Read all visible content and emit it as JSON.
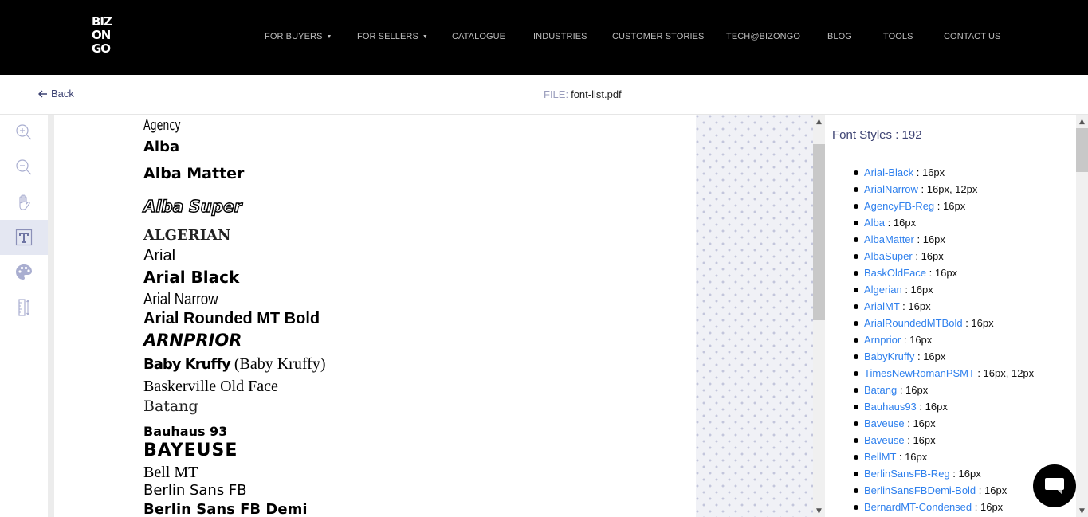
{
  "brand": {
    "logo_lines": [
      "BIZ",
      "ON",
      "GO"
    ]
  },
  "nav": {
    "items": [
      {
        "label": "FOR BUYERS",
        "has_dropdown": true
      },
      {
        "label": "FOR SELLERS",
        "has_dropdown": true
      },
      {
        "label": "CATALOGUE",
        "has_dropdown": false
      },
      {
        "label": "INDUSTRIES",
        "has_dropdown": false
      },
      {
        "label": "CUSTOMER STORIES",
        "has_dropdown": false
      },
      {
        "label": "TECH@BIZONGO",
        "has_dropdown": false
      },
      {
        "label": "BLOG",
        "has_dropdown": false
      },
      {
        "label": "TOOLS",
        "has_dropdown": false
      },
      {
        "label": "CONTACT US",
        "has_dropdown": false
      }
    ],
    "caret": "▼"
  },
  "subheader": {
    "back_label": "Back",
    "file_prefix": "FILE:",
    "file_name": "font-list.pdf"
  },
  "tools": [
    {
      "name": "zoom-in",
      "icon": "zoom-in-icon",
      "active": false
    },
    {
      "name": "zoom-out",
      "icon": "zoom-out-icon",
      "active": false
    },
    {
      "name": "pan",
      "icon": "hand-icon",
      "active": false
    },
    {
      "name": "text",
      "icon": "text-tool-icon",
      "active": true
    },
    {
      "name": "color",
      "icon": "palette-icon",
      "active": false
    },
    {
      "name": "measure",
      "icon": "ruler-icon",
      "active": false
    }
  ],
  "document": {
    "lines": [
      {
        "text": "Agency"
      },
      {
        "text": "Alba"
      },
      {
        "text": "Alba Matter"
      },
      {
        "text": "Alba Super"
      },
      {
        "text": "ALGERIAN"
      },
      {
        "text": "Arial"
      },
      {
        "text": "Arial Black"
      },
      {
        "text": "Arial Narrow"
      },
      {
        "text": "Arial Rounded MT Bold"
      },
      {
        "text": "ARNPRIOR"
      },
      {
        "text": "Baby Kruffy",
        "suffix": "(Baby Kruffy)"
      },
      {
        "text": "Baskerville Old Face"
      },
      {
        "text": "Batang"
      },
      {
        "text": "Bauhaus 93"
      },
      {
        "text": "BAYEUSE"
      },
      {
        "text": "Bell MT"
      },
      {
        "text": "Berlin Sans FB"
      },
      {
        "text": "Berlin Sans FB Demi"
      }
    ]
  },
  "panel": {
    "title": "Font Styles : 192",
    "fonts": [
      {
        "name": "Arial-Black",
        "sizes": "16px"
      },
      {
        "name": "ArialNarrow",
        "sizes": "16px, 12px"
      },
      {
        "name": "AgencyFB-Reg",
        "sizes": "16px"
      },
      {
        "name": "Alba",
        "sizes": "16px"
      },
      {
        "name": "AlbaMatter",
        "sizes": "16px"
      },
      {
        "name": "AlbaSuper",
        "sizes": "16px"
      },
      {
        "name": "BaskOldFace",
        "sizes": "16px"
      },
      {
        "name": "Algerian",
        "sizes": "16px"
      },
      {
        "name": "ArialMT",
        "sizes": "16px"
      },
      {
        "name": "ArialRoundedMTBold",
        "sizes": "16px"
      },
      {
        "name": "Arnprior",
        "sizes": "16px"
      },
      {
        "name": "BabyKruffy",
        "sizes": "16px"
      },
      {
        "name": "TimesNewRomanPSMT",
        "sizes": "16px, 12px"
      },
      {
        "name": "Batang",
        "sizes": "16px"
      },
      {
        "name": "Bauhaus93",
        "sizes": "16px"
      },
      {
        "name": "Baveuse",
        "sizes": "16px"
      },
      {
        "name": "Baveuse",
        "sizes": "16px"
      },
      {
        "name": "BellMT",
        "sizes": "16px"
      },
      {
        "name": "BerlinSansFB-Reg",
        "sizes": "16px"
      },
      {
        "name": "BerlinSansFBDemi-Bold",
        "sizes": "16px"
      },
      {
        "name": "BernardMT-Condensed",
        "sizes": "16px"
      }
    ]
  },
  "colors": {
    "nav_bg": "#000000",
    "nav_text": "#bdbdbd",
    "link": "#2f80ed",
    "heading": "#3d4373",
    "active_tool_bg": "#e4e7f2"
  }
}
